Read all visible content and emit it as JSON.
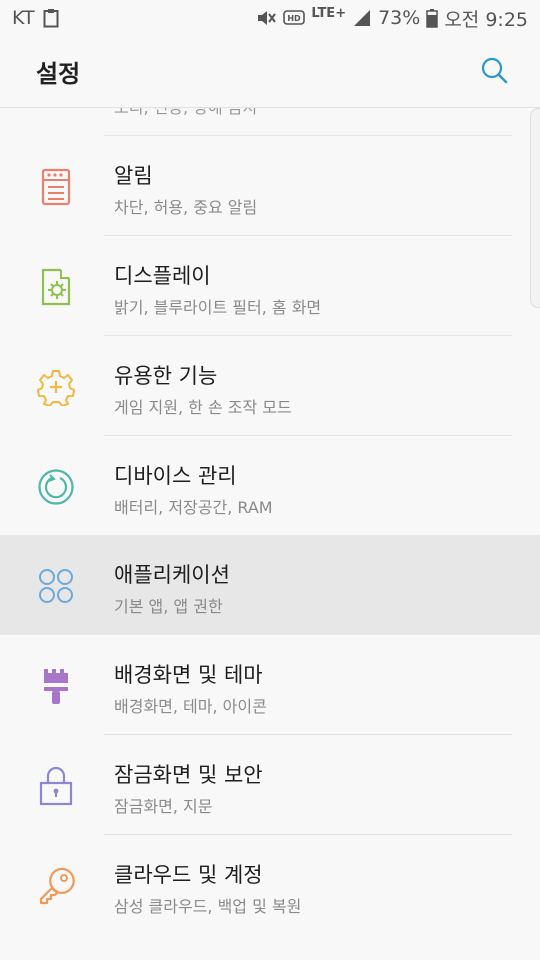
{
  "status": {
    "carrier": "KT",
    "network": "LTE+",
    "battery": "73%",
    "time": "오전 9:25"
  },
  "header": {
    "title": "설정"
  },
  "partial_item": {
    "subtitle": "소리, 진동, 방해 금지"
  },
  "items": [
    {
      "title": "알림",
      "subtitle": "차단, 허용, 중요 알림",
      "icon": "notification-icon",
      "color": "#e8806f"
    },
    {
      "title": "디스플레이",
      "subtitle": "밝기, 블루라이트 필터, 홈 화면",
      "icon": "display-icon",
      "color": "#8fbf4c"
    },
    {
      "title": "유용한 기능",
      "subtitle": "게임 지원, 한 손 조작 모드",
      "icon": "gear-plus-icon",
      "color": "#f0b946"
    },
    {
      "title": "디바이스 관리",
      "subtitle": "배터리, 저장공간, RAM",
      "icon": "device-care-icon",
      "color": "#4fb8a6"
    },
    {
      "title": "애플리케이션",
      "subtitle": "기본 앱, 앱 권한",
      "icon": "apps-icon",
      "color": "#6aa9e0"
    },
    {
      "title": "배경화면 및 테마",
      "subtitle": "배경화면, 테마, 아이콘",
      "icon": "paintbrush-icon",
      "color": "#a776c9"
    },
    {
      "title": "잠금화면 및 보안",
      "subtitle": "잠금화면, 지문",
      "icon": "lock-icon",
      "color": "#8b88cf"
    },
    {
      "title": "클라우드 및 계정",
      "subtitle": "삼성 클라우드, 백업 및 복원",
      "icon": "key-icon",
      "color": "#f09a5a"
    }
  ]
}
